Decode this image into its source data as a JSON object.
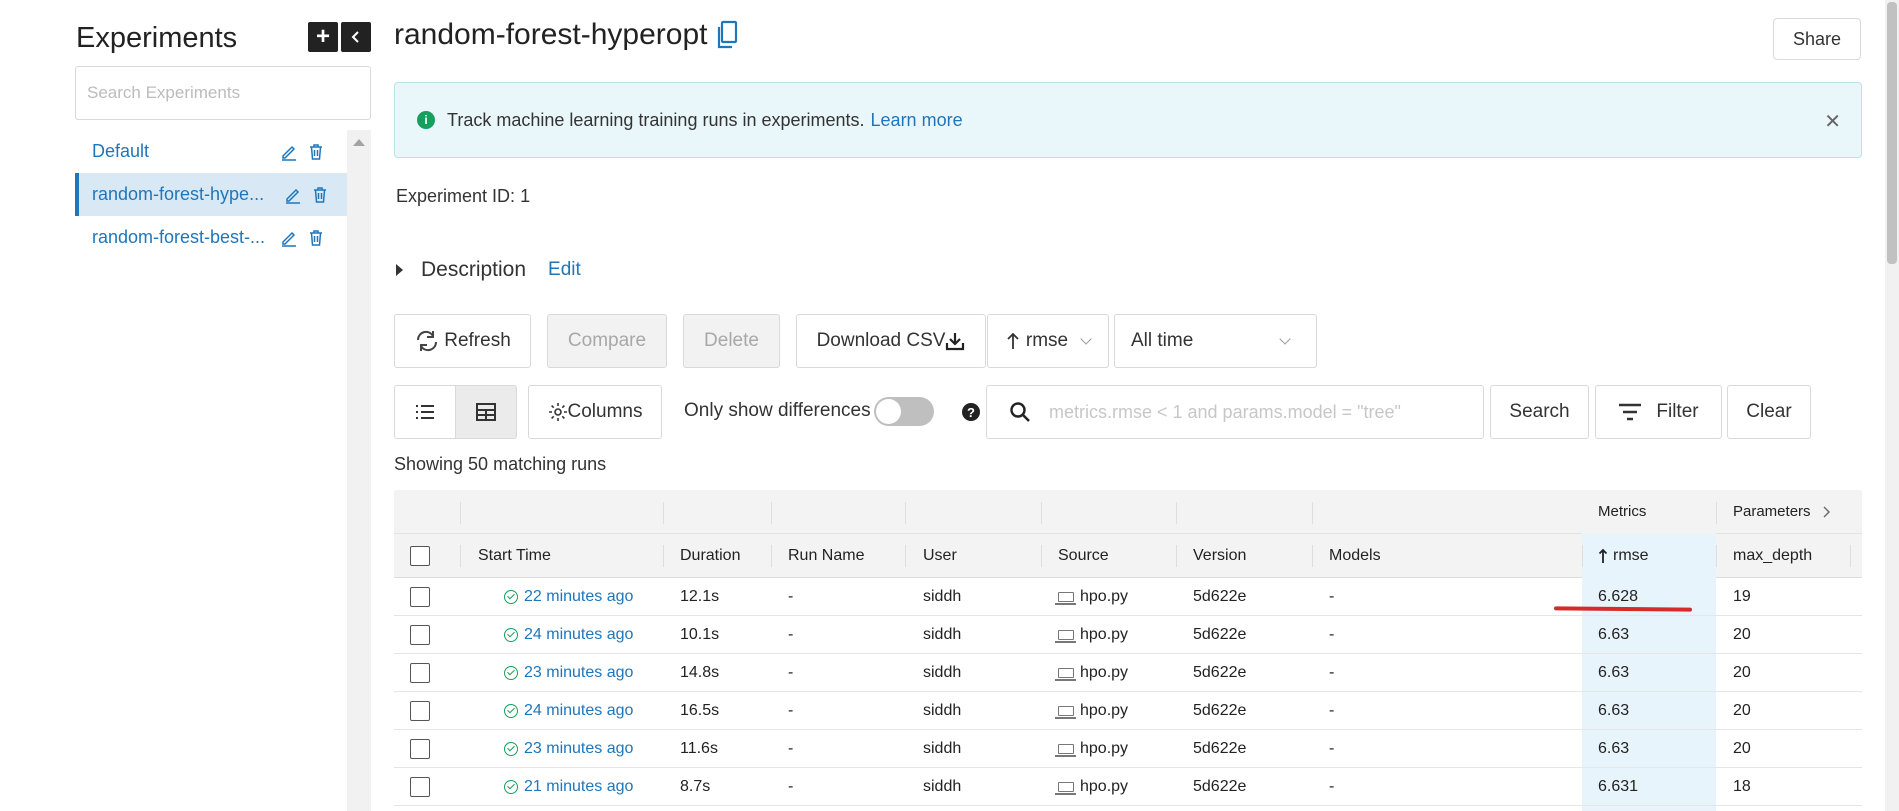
{
  "sidebar": {
    "title": "Experiments",
    "search_placeholder": "Search Experiments",
    "items": [
      {
        "label": "Default"
      },
      {
        "label": "random-forest-hype..."
      },
      {
        "label": "random-forest-best-..."
      }
    ]
  },
  "header": {
    "title": "random-forest-hyperopt",
    "share_label": "Share"
  },
  "banner": {
    "text": "Track machine learning training runs in experiments.",
    "link": "Learn more"
  },
  "experiment": {
    "id_label": "Experiment ID:",
    "id_value": "1",
    "description_label": "Description",
    "edit_label": "Edit"
  },
  "toolbar": {
    "refresh": "Refresh",
    "compare": "Compare",
    "delete": "Delete",
    "download_csv": "Download CSV",
    "sort_value": "rmse",
    "time_value": "All time",
    "columns": "Columns",
    "only_show_differences": "Only show differences",
    "search_placeholder": "metrics.rmse < 1 and params.model = \"tree\"",
    "search": "Search",
    "filter": "Filter",
    "clear": "Clear"
  },
  "showing_text": "Showing 50 matching runs",
  "table": {
    "groups": {
      "metrics": "Metrics",
      "parameters": "Parameters"
    },
    "columns": [
      "Start Time",
      "Duration",
      "Run Name",
      "User",
      "Source",
      "Version",
      "Models",
      "rmse",
      "max_depth"
    ],
    "rows": [
      {
        "start": "22 minutes ago",
        "duration": "12.1s",
        "run_name": "-",
        "user": "siddh",
        "source": "hpo.py",
        "version": "5d622e",
        "models": "-",
        "rmse": "6.628",
        "max_depth": "19"
      },
      {
        "start": "24 minutes ago",
        "duration": "10.1s",
        "run_name": "-",
        "user": "siddh",
        "source": "hpo.py",
        "version": "5d622e",
        "models": "-",
        "rmse": "6.63",
        "max_depth": "20"
      },
      {
        "start": "23 minutes ago",
        "duration": "14.8s",
        "run_name": "-",
        "user": "siddh",
        "source": "hpo.py",
        "version": "5d622e",
        "models": "-",
        "rmse": "6.63",
        "max_depth": "20"
      },
      {
        "start": "24 minutes ago",
        "duration": "16.5s",
        "run_name": "-",
        "user": "siddh",
        "source": "hpo.py",
        "version": "5d622e",
        "models": "-",
        "rmse": "6.63",
        "max_depth": "20"
      },
      {
        "start": "23 minutes ago",
        "duration": "11.6s",
        "run_name": "-",
        "user": "siddh",
        "source": "hpo.py",
        "version": "5d622e",
        "models": "-",
        "rmse": "6.63",
        "max_depth": "20"
      },
      {
        "start": "21 minutes ago",
        "duration": "8.7s",
        "run_name": "-",
        "user": "siddh",
        "source": "hpo.py",
        "version": "5d622e",
        "models": "-",
        "rmse": "6.631",
        "max_depth": "18"
      }
    ]
  },
  "colors": {
    "accent": "#1f76bb",
    "success": "#17a05d",
    "annotation": "#d42b2b",
    "banner_bg": "#e9f7fb"
  }
}
